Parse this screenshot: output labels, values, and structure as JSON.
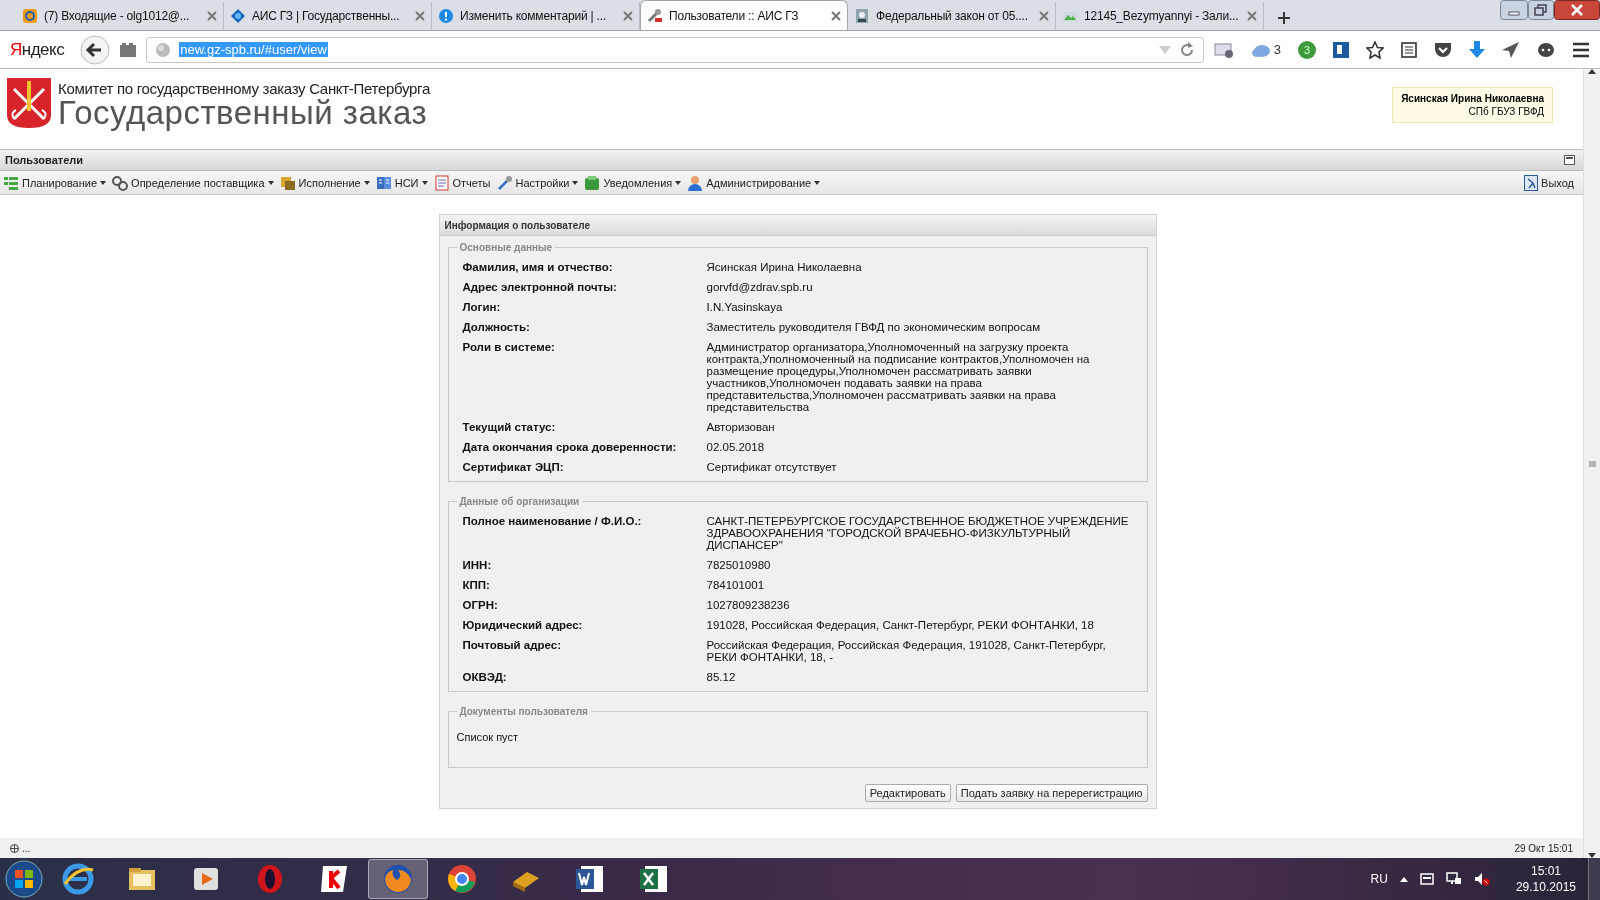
{
  "browser": {
    "tabs": [
      {
        "title": "(7) Входящие - olg1012@...",
        "selected": false
      },
      {
        "title": "АИС ГЗ | Государственны...",
        "selected": false
      },
      {
        "title": "Изменить комментарий | ...",
        "selected": false
      },
      {
        "title": "Пользователи :: АИС ГЗ",
        "selected": true
      },
      {
        "title": "Федеральный закон от 05....",
        "selected": false
      },
      {
        "title": "12145_Bezymyannyi - Зали...",
        "selected": false
      }
    ],
    "brand": "Яндекс",
    "url": "new.gz-spb.ru/#user/view",
    "cloud_count": "3",
    "badge_count": "3"
  },
  "header": {
    "subtitle": "Комитет по государственному заказу Санкт-Петербурга",
    "title": "Государственный заказ",
    "user": {
      "name": "Ясинская Ирина Николаевна",
      "org": "СПб ГБУЗ ГВФД"
    }
  },
  "section_title": "Пользователи",
  "menu": {
    "items": [
      {
        "label": "Планирование",
        "dropdown": true
      },
      {
        "label": "Определение поставщика",
        "dropdown": true
      },
      {
        "label": "Исполнение",
        "dropdown": true
      },
      {
        "label": "НСИ",
        "dropdown": true
      },
      {
        "label": "Отчеты",
        "dropdown": false
      },
      {
        "label": "Настройки",
        "dropdown": true
      },
      {
        "label": "Уведомления",
        "dropdown": true
      },
      {
        "label": "Администрирование",
        "dropdown": true
      }
    ],
    "exit": "Выход"
  },
  "panel": {
    "title": "Информация о пользователе",
    "groups": [
      {
        "legend": "Основные данные",
        "rows": [
          {
            "label": "Фамилия, имя и отчество:",
            "value": "Ясинская Ирина Николаевна"
          },
          {
            "label": "Адрес электронной почты:",
            "value": "gorvfd@zdrav.spb.ru"
          },
          {
            "label": "Логин:",
            "value": "I.N.Yasinskaya"
          },
          {
            "label": "Должность:",
            "value": "Заместитель руководителя ГВФД по экономическим вопросам"
          },
          {
            "label": "Роли в системе:",
            "value": "Администратор организатора,Уполномоченный на загрузку проекта контракта,Уполномоченный на подписание контрактов,Уполномочен на размещение процедуры,Уполномочен рассматривать заявки участников,Уполномочен подавать заявки на права представительства,Уполномочен рассматривать заявки на права представительства"
          },
          {
            "label": "Текущий статус:",
            "value": "Авторизован"
          },
          {
            "label": "Дата окончания срока доверенности:",
            "value": "02.05.2018"
          },
          {
            "label": "Сертификат ЭЦП:",
            "value": "Сертификат отсутствует"
          }
        ]
      },
      {
        "legend": "Данные об организации",
        "rows": [
          {
            "label": "Полное наименование / Ф.И.О.:",
            "value": "САНКТ-ПЕТЕРБУРГСКОЕ ГОСУДАРСТВЕННОЕ БЮДЖЕТНОЕ УЧРЕЖДЕНИЕ ЗДРАВООХРАНЕНИЯ \"ГОРОДСКОЙ ВРАЧЕБНО-ФИЗКУЛЬТУРНЫЙ ДИСПАНСЕР\""
          },
          {
            "label": "ИНН:",
            "value": "7825010980"
          },
          {
            "label": "КПП:",
            "value": "784101001"
          },
          {
            "label": "ОГРН:",
            "value": "1027809238236"
          },
          {
            "label": "Юридический адрес:",
            "value": "191028, Российская Федерация, Санкт-Петербург, РЕКИ ФОНТАНКИ, 18"
          },
          {
            "label": "Почтовый адрес:",
            "value": "Российская Федерация, Российская Федерация, 191028, Санкт-Петербург, РЕКИ ФОНТАНКИ, 18, -"
          },
          {
            "label": "ОКВЭД:",
            "value": "85.12"
          }
        ]
      }
    ],
    "documents": {
      "legend": "Документы пользователя",
      "empty_text": "Список пуст"
    },
    "buttons": [
      {
        "label": "Редактировать"
      },
      {
        "label": "Подать заявку на перерегистрацию"
      }
    ]
  },
  "status_bar": {
    "left": "...",
    "right": "29 Окт 15:01"
  },
  "taskbar": {
    "apps": [
      {
        "selected": false
      },
      {
        "selected": false
      },
      {
        "selected": false
      },
      {
        "selected": false
      },
      {
        "selected": false
      },
      {
        "selected": true
      },
      {
        "selected": false
      },
      {
        "selected": false
      },
      {
        "selected": false
      },
      {
        "selected": false
      }
    ],
    "language": "RU",
    "time": "15:01",
    "date": "29.10.2015"
  }
}
